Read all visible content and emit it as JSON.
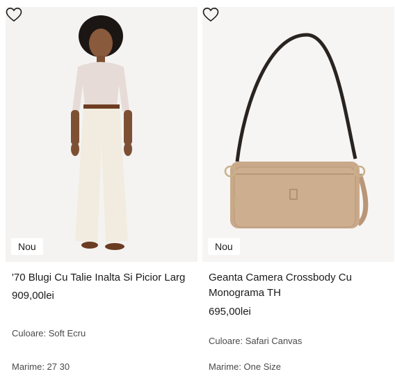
{
  "products": [
    {
      "badge": "Nou",
      "title": "'70 Blugi Cu Talie Inalta Si Picior Larg",
      "price": "909,00lei",
      "color": "Culoare: Soft Ecru",
      "size": "Marime: 27 30",
      "image": "woman-white-wide-leg-jeans"
    },
    {
      "badge": "Nou",
      "title": "Geanta Camera Crossbody Cu Monograma TH",
      "price": "695,00lei",
      "color": "Culoare: Safari Canvas",
      "size": "Marime: One Size",
      "image": "tan-crossbody-camera-bag"
    }
  ],
  "icons": {
    "wishlist": "heart-outline-icon"
  },
  "colors": {
    "image_bg": "#f3f2f1",
    "text": "#1a1a1a",
    "meta": "#4a4a4a",
    "bag": "#c9a98a"
  }
}
